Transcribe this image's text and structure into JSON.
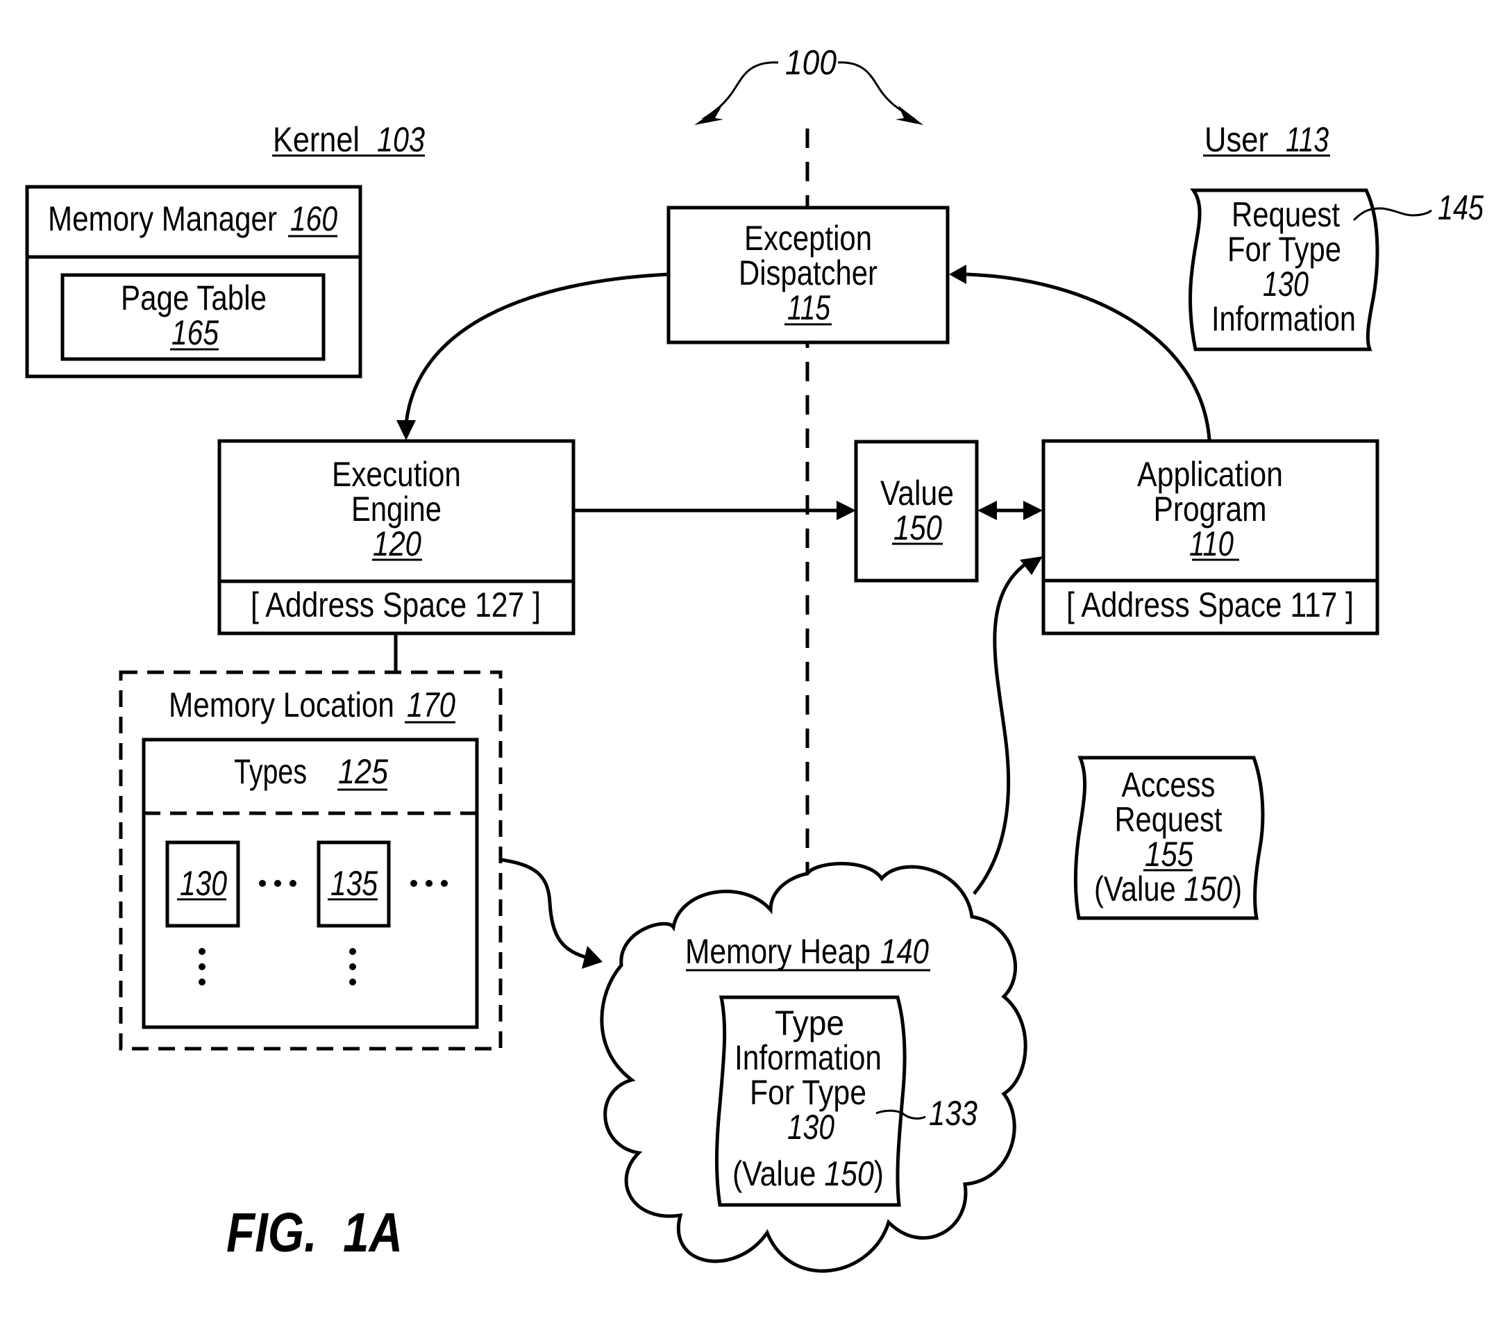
{
  "figure": {
    "title": "FIG.  1A",
    "system_ref": "100"
  },
  "regions": {
    "kernel": {
      "label": "Kernel",
      "ref": "103"
    },
    "user": {
      "label": "User",
      "ref": "113"
    }
  },
  "components": {
    "memory_manager": {
      "label": "Memory Manager",
      "ref": "160"
    },
    "page_table": {
      "line1": "Page Table",
      "ref": "165"
    },
    "exception_dispatcher": {
      "line1": "Exception",
      "line2": "Dispatcher",
      "ref": "115"
    },
    "execution_engine": {
      "line1": "Execution",
      "line2": "Engine",
      "ref": "120",
      "address_space": "[ Address Space 127 ]"
    },
    "value": {
      "line1": "Value",
      "ref": "150"
    },
    "application_program": {
      "line1": "Application",
      "line2": "Program",
      "ref": "110",
      "address_space": "[ Address Space 117 ]"
    },
    "request_note": {
      "line1": "Request",
      "line2": "For Type",
      "line3": "130",
      "line4": "Information",
      "ref": "145"
    },
    "memory_location": {
      "label": "Memory Location",
      "ref": "170"
    },
    "types": {
      "label": "Types",
      "ref": "125",
      "type_a": "130",
      "type_b": "135",
      "ellipsis": "• • •"
    },
    "memory_heap": {
      "label": "Memory Heap",
      "ref": "140"
    },
    "type_info_note": {
      "line1": "Type",
      "line2": "Information",
      "line3": "For Type",
      "line4": "130",
      "line5_prefix": "(Value ",
      "line5_num": "150",
      "line5_suffix": ")",
      "ref": "133"
    },
    "access_request": {
      "line1": "Access",
      "line2": "Request",
      "ref": "155",
      "line4_prefix": "(Value ",
      "line4_num": "150",
      "line4_suffix": ")"
    }
  }
}
